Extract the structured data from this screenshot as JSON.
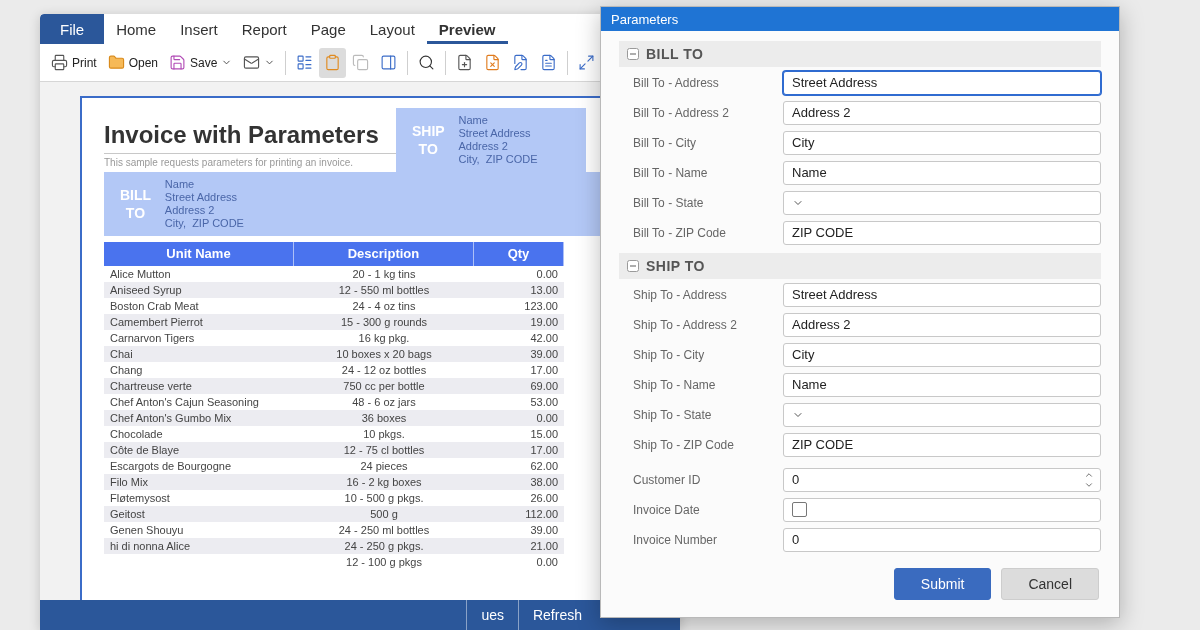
{
  "app": {
    "tabs": [
      {
        "label": "File",
        "kind": "file",
        "selected": false
      },
      {
        "label": "Home",
        "kind": "tab",
        "selected": false
      },
      {
        "label": "Insert",
        "kind": "tab",
        "selected": false
      },
      {
        "label": "Report",
        "kind": "tab",
        "selected": false
      },
      {
        "label": "Page",
        "kind": "tab",
        "selected": false
      },
      {
        "label": "Layout",
        "kind": "tab",
        "selected": false
      },
      {
        "label": "Preview",
        "kind": "tab",
        "selected": true
      }
    ],
    "toolbar": {
      "groups": [
        [
          {
            "label": "Print",
            "dropdown": false,
            "pressed": false,
            "disabled": false
          },
          {
            "label": "Open",
            "dropdown": false,
            "pressed": false,
            "disabled": false
          },
          {
            "label": "Save",
            "dropdown": true,
            "pressed": false,
            "disabled": false
          },
          {
            "dropdown": true,
            "pressed": false,
            "disabled": false
          }
        ],
        [
          {
            "dropdown": false,
            "pressed": false,
            "disabled": false
          },
          {
            "dropdown": false,
            "pressed": true,
            "disabled": false
          },
          {
            "dropdown": false,
            "pressed": false,
            "disabled": true
          },
          {
            "dropdown": false,
            "pressed": false,
            "disabled": false
          }
        ],
        [
          {
            "dropdown": false,
            "pressed": false,
            "disabled": false
          }
        ],
        [
          {
            "dropdown": false,
            "pressed": false,
            "disabled": false
          },
          {
            "dropdown": false,
            "pressed": false,
            "disabled": false
          },
          {
            "dropdown": false,
            "pressed": false,
            "disabled": false
          },
          {
            "dropdown": false,
            "pressed": false,
            "disabled": false
          }
        ],
        [
          {
            "dropdown": false,
            "pressed": false,
            "disabled": false
          }
        ]
      ]
    },
    "document": {
      "title": "Invoice with Parameters",
      "subtitle": "This sample requests parameters for printing an invoice.",
      "ship_to": {
        "heading": "SHIP TO",
        "lines": [
          "Name",
          "Street Address",
          "Address 2",
          "City,  ZIP CODE"
        ]
      },
      "bill_to": {
        "heading": "BILL TO",
        "lines": [
          "Name",
          "Street Address",
          "Address 2",
          "City,  ZIP CODE"
        ]
      },
      "table": {
        "columns": [
          "Unit Name",
          "Description",
          "Qty"
        ],
        "rows": [
          {
            "name": "Alice Mutton",
            "description": "20 - 1 kg tins",
            "qty": "0.00"
          },
          {
            "name": "Aniseed Syrup",
            "description": "12 - 550 ml bottles",
            "qty": "13.00"
          },
          {
            "name": "Boston Crab Meat",
            "description": "24 - 4 oz tins",
            "qty": "123.00"
          },
          {
            "name": "Camembert Pierrot",
            "description": "15 - 300 g rounds",
            "qty": "19.00"
          },
          {
            "name": "Carnarvon Tigers",
            "description": "16 kg pkg.",
            "qty": "42.00"
          },
          {
            "name": "Chai",
            "description": "10 boxes x 20 bags",
            "qty": "39.00"
          },
          {
            "name": "Chang",
            "description": "24 - 12 oz bottles",
            "qty": "17.00"
          },
          {
            "name": "Chartreuse verte",
            "description": "750 cc per bottle",
            "qty": "69.00"
          },
          {
            "name": "Chef Anton's Cajun Seasoning",
            "description": "48 - 6 oz jars",
            "qty": "53.00"
          },
          {
            "name": "Chef Anton's Gumbo Mix",
            "description": "36 boxes",
            "qty": "0.00"
          },
          {
            "name": "Chocolade",
            "description": "10 pkgs.",
            "qty": "15.00"
          },
          {
            "name": "Côte de Blaye",
            "description": "12 - 75 cl bottles",
            "qty": "17.00"
          },
          {
            "name": "Escargots de Bourgogne",
            "description": "24 pieces",
            "qty": "62.00"
          },
          {
            "name": "Filo Mix",
            "description": "16 - 2 kg boxes",
            "qty": "38.00"
          },
          {
            "name": "Fløtemysost",
            "description": "10 - 500 g pkgs.",
            "qty": "26.00"
          },
          {
            "name": "Geitost",
            "description": "500 g",
            "qty": "112.00"
          },
          {
            "name": "Genen Shouyu",
            "description": "24 - 250 ml bottles",
            "qty": "39.00"
          },
          {
            "name": "hi di nonna Alice",
            "description": "24 - 250 g pkgs.",
            "qty": "21.00"
          },
          {
            "description": "12 - 100 g pkgs",
            "qty": "0.00"
          }
        ]
      }
    },
    "footer": {
      "buttons": [
        "ues",
        "Refresh"
      ]
    }
  },
  "dialog": {
    "title": "Parameters",
    "sections": [
      {
        "heading": "BILL TO",
        "expanded": true,
        "fields": [
          {
            "label": "Bill To - Address",
            "kind": "text",
            "value": "Street Address",
            "focused": true
          },
          {
            "label": "Bill To - Address 2",
            "kind": "text",
            "value": "Address 2",
            "focused": false
          },
          {
            "label": "Bill To - City",
            "kind": "text",
            "value": "City",
            "focused": false
          },
          {
            "label": "Bill To - Name",
            "kind": "text",
            "value": "Name",
            "focused": false
          },
          {
            "label": "Bill To - State",
            "kind": "dropdown",
            "focused": false
          },
          {
            "label": "Bill To - ZIP Code",
            "kind": "text",
            "value": "ZIP CODE",
            "focused": false
          }
        ]
      },
      {
        "heading": "SHIP TO",
        "expanded": true,
        "fields": [
          {
            "label": "Ship To - Address",
            "kind": "text",
            "value": "Street Address",
            "focused": false
          },
          {
            "label": "Ship To - Address 2",
            "kind": "text",
            "value": "Address 2",
            "focused": false
          },
          {
            "label": "Ship To - City",
            "kind": "text",
            "value": "City",
            "focused": false
          },
          {
            "label": "Ship To - Name",
            "kind": "text",
            "value": "Name",
            "focused": false
          },
          {
            "label": "Ship To - State",
            "kind": "dropdown",
            "focused": false
          },
          {
            "label": "Ship To - ZIP Code",
            "kind": "text",
            "value": "ZIP CODE",
            "focused": false
          }
        ]
      }
    ],
    "fields": [
      {
        "label": "Customer ID",
        "kind": "spinner",
        "value": "0",
        "focused": false
      },
      {
        "label": "Invoice Date",
        "kind": "date",
        "checked": false,
        "focused": false
      },
      {
        "label": "Invoice Number",
        "kind": "text",
        "value": "0",
        "focused": false
      }
    ],
    "buttons": [
      {
        "label": "Submit",
        "kind": "primary"
      },
      {
        "label": "Cancel",
        "kind": "secondary"
      }
    ]
  }
}
